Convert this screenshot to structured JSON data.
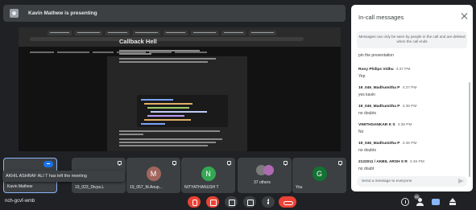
{
  "presenter_banner": {
    "text": "Kavin Mathew is presenting"
  },
  "shared_screen": {
    "doc_title": "Callback Hell"
  },
  "participants": [
    {
      "name": "Kavin Mathew"
    },
    {
      "name": "19_023_Divya.L"
    },
    {
      "name": "19_057_M.Anup...",
      "initial": "M",
      "color": "#a1665e"
    },
    {
      "name": "NITYATHANUSH T",
      "initial": "N",
      "color": "#34a853"
    },
    {
      "name": "37 others"
    },
    {
      "name": "You",
      "initial": "G",
      "color": "#137333"
    }
  ],
  "toast": {
    "text": "AKHIL ASHRAF ALI T has left the meeting"
  },
  "bottom_bar": {
    "meeting_code": "nch-gcvf-wmb",
    "people_count": "45"
  },
  "chat_panel": {
    "title": "In-call messages",
    "notice": "Messages can only be seen by people in the call and are deleted when the call ends",
    "orphan_text": "pin the presentation",
    "messages": [
      {
        "sender": "Rony Philips Vidhu",
        "time": "4:37 PM",
        "text": "Yep"
      },
      {
        "sender": "19_046_Madhumitha P",
        "time": "4:37 PM",
        "text": "yes kavin"
      },
      {
        "sender": "19_046_Madhumitha P",
        "time": "4:38 PM",
        "text": "no doubts"
      },
      {
        "sender": "VINITHSANKAR K S",
        "time": "4:38 PM",
        "text": "No"
      },
      {
        "sender": "19_046_Madhumitha P",
        "time": "4:46 PM",
        "text": "no doubts"
      },
      {
        "sender": "2122011 / AKBIL ARSH S R",
        "time": "4:46 PM",
        "text": "no doubt"
      }
    ],
    "compose_placeholder": "Send a message to everyone"
  },
  "colors": {
    "background": "#202124",
    "hangup": "#ea4335",
    "accent": "#8ab4f8"
  },
  "icons": [
    "presenter-icon",
    "pin-icon",
    "mic-off-icon",
    "camera-off-icon",
    "captions-icon",
    "present-icon",
    "more-icon",
    "hangup-icon",
    "info-icon",
    "people-icon",
    "chat-icon",
    "activities-icon",
    "close-icon",
    "send-icon"
  ]
}
